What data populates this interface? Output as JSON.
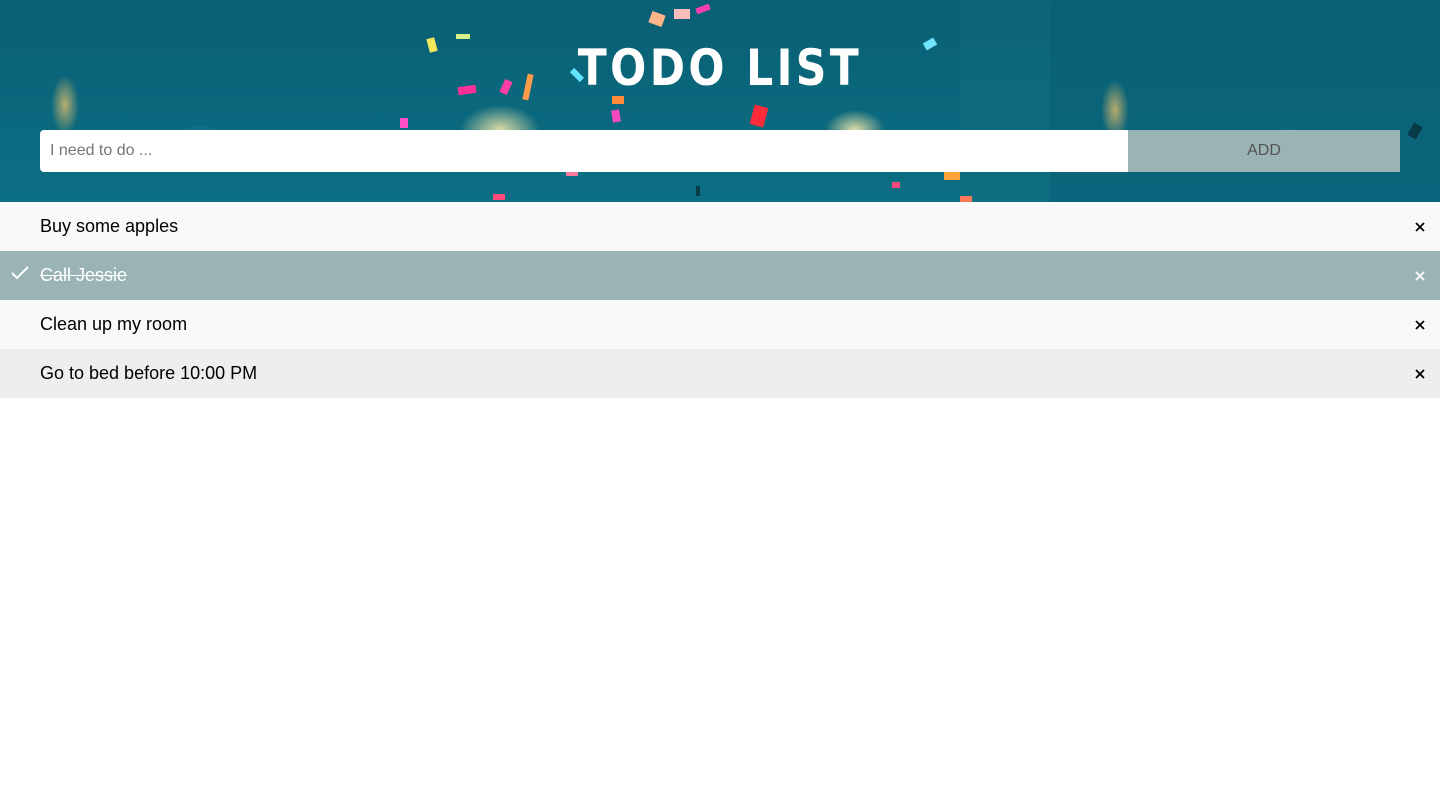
{
  "header": {
    "title": "TODO LIST"
  },
  "input": {
    "placeholder": "I need to do ...",
    "value": ""
  },
  "add_button_label": "ADD",
  "todos": [
    {
      "text": "Buy some apples",
      "checked": false
    },
    {
      "text": "Call Jessie",
      "checked": true
    },
    {
      "text": "Clean up my room",
      "checked": false
    },
    {
      "text": "Go to bed before 10:00 PM",
      "checked": false
    }
  ],
  "colors": {
    "header_bg": "#0b6a7e",
    "accent": "#9ab3b4",
    "row_light": "#f9f9f9",
    "row_dark": "#eeeeee"
  },
  "icons": {
    "check": "check-icon",
    "close": "close-icon"
  }
}
